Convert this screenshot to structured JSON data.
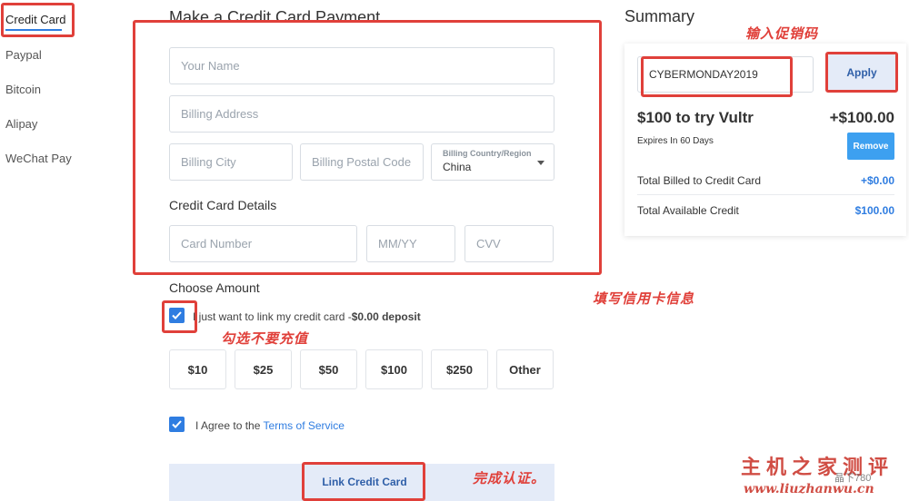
{
  "sidebar": {
    "items": [
      {
        "label": "Credit Card"
      },
      {
        "label": "Paypal"
      },
      {
        "label": "Bitcoin"
      },
      {
        "label": "Alipay"
      },
      {
        "label": "WeChat Pay"
      }
    ]
  },
  "main": {
    "title": "Make a Credit Card Payment",
    "your_name_placeholder": "Your Name",
    "billing_address_placeholder": "Billing Address",
    "billing_city_placeholder": "Billing City",
    "billing_postal_placeholder": "Billing Postal Code",
    "country_label": "Billing Country/Region",
    "country_value": "China",
    "card_details_title": "Credit Card Details",
    "card_number_placeholder": "Card Number",
    "expiry_placeholder": "MM/YY",
    "cvv_placeholder": "CVV",
    "choose_amount_title": "Choose Amount",
    "link_only_text": "I just want to link my credit card -",
    "deposit_text": "$0.00 deposit",
    "amounts": [
      "$10",
      "$25",
      "$50",
      "$100",
      "$250",
      "Other"
    ],
    "agree_text": "I Agree to the ",
    "terms_link": "Terms of Service",
    "link_button": "Link Credit Card"
  },
  "summary": {
    "title": "Summary",
    "promo_code": "CYBERMONDAY2019",
    "apply_button": "Apply",
    "promo_name": "$100 to try Vultr",
    "promo_amount": "+$100.00",
    "expires": "Expires In 60 Days",
    "remove_button": "Remove",
    "billed_label": "Total Billed to Credit Card",
    "billed_value": "+$0.00",
    "credit_label": "Total Available Credit",
    "credit_value": "$100.00"
  },
  "annotations": {
    "promo": "输入促销码",
    "card_info": "填写信用卡信息",
    "no_recharge": "勾选不要充值",
    "done": "完成认证。"
  },
  "watermark": {
    "site_cn": "主机之家测评",
    "site_url": "www.liuzhanwu.cn",
    "extra": "晶下780"
  },
  "colors": {
    "accent": "#2f7de1",
    "annotation_red": "#e0403a",
    "apply_bg": "#e4ebf8",
    "link_bar_bg": "#e4ebf8"
  }
}
